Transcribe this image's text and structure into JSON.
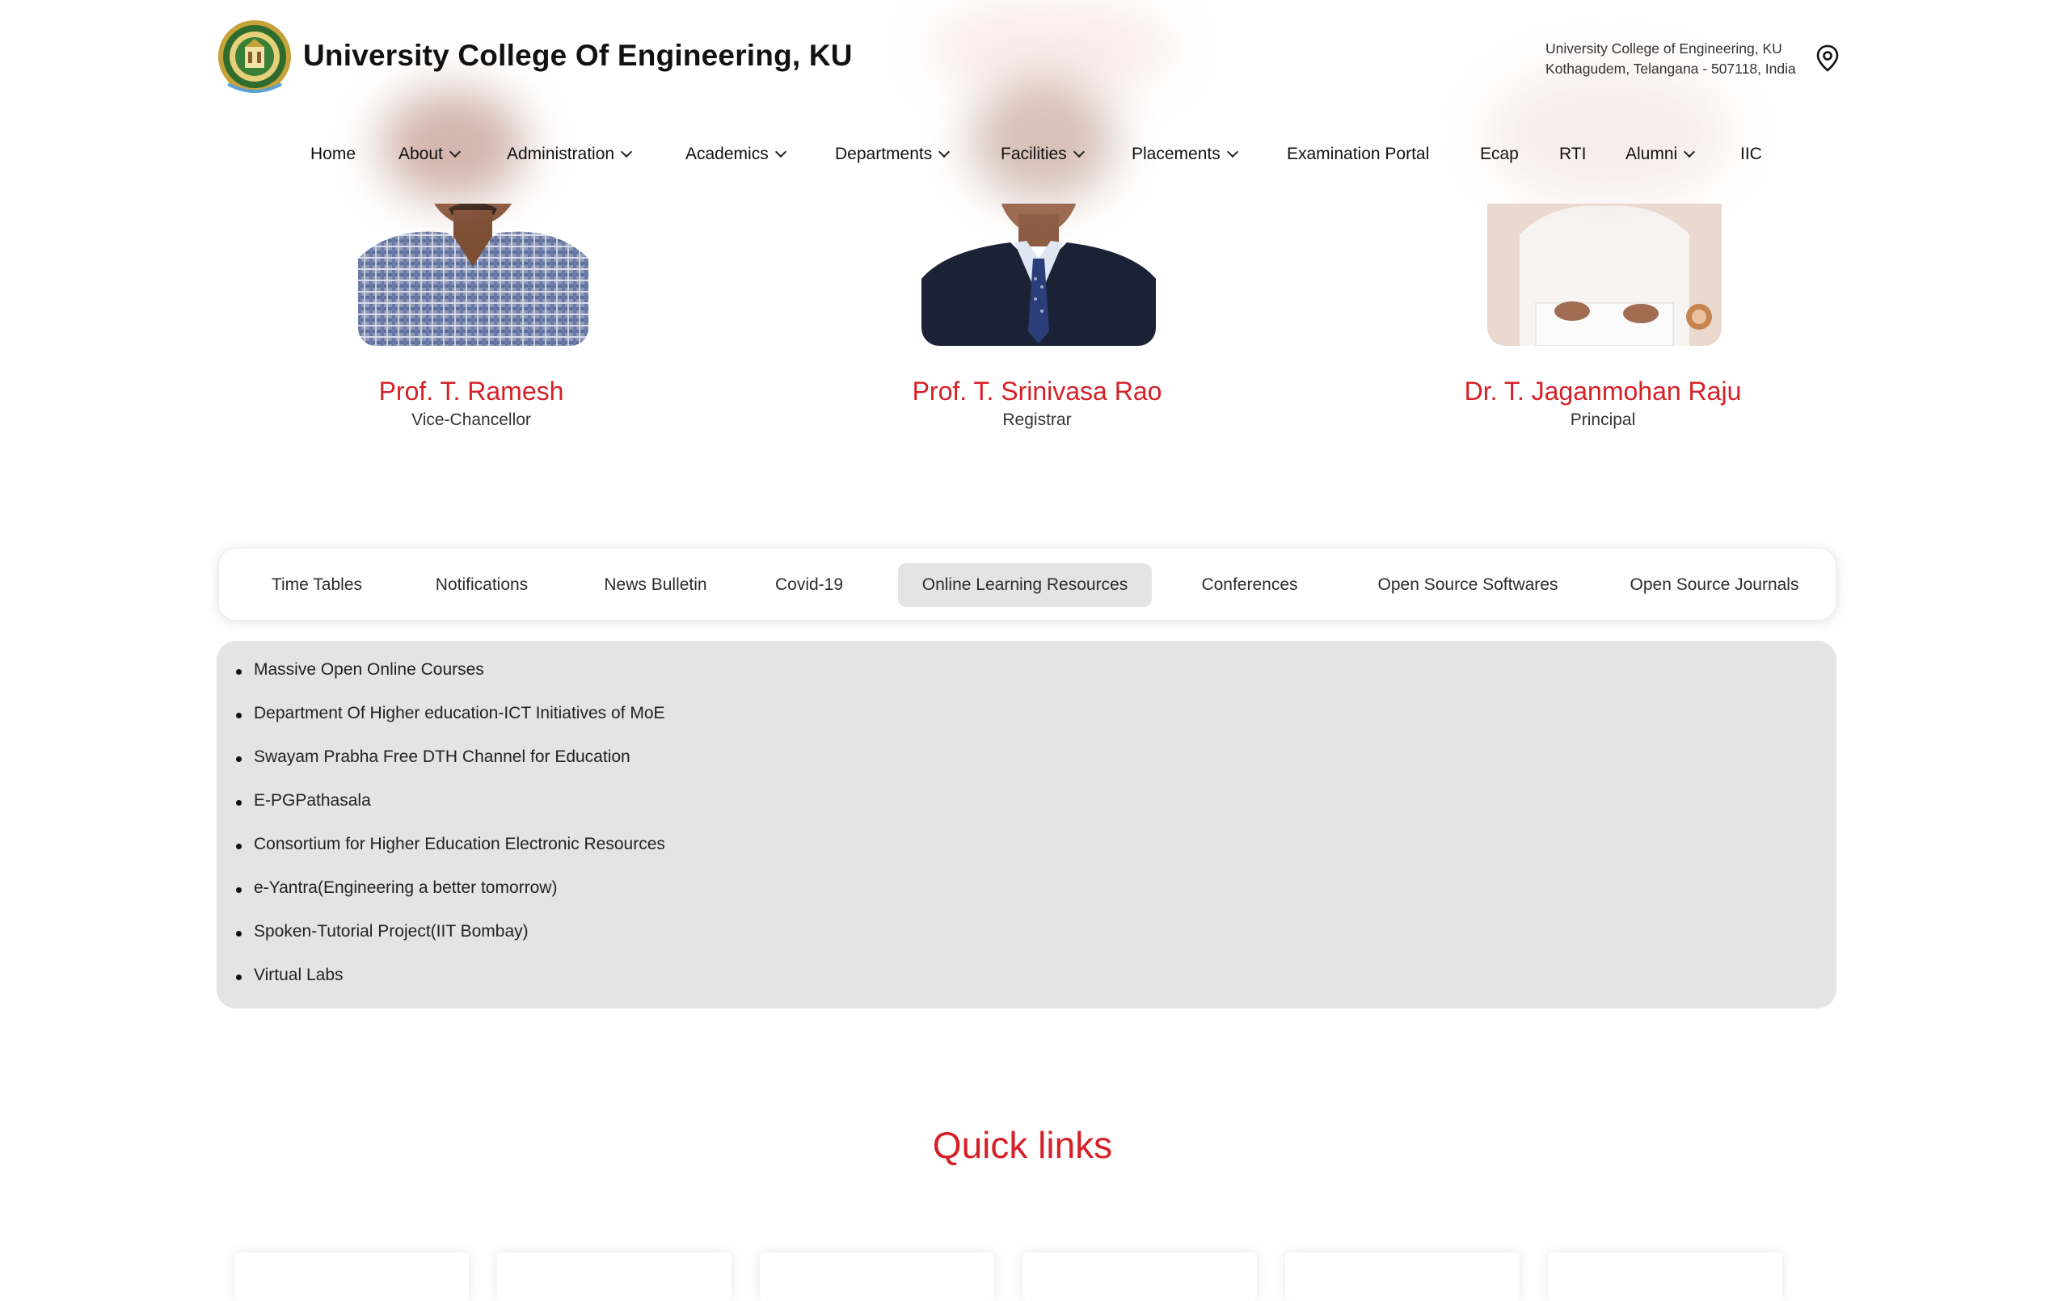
{
  "header": {
    "title": "University College Of Engineering, KU",
    "address_line1": "University College of Engineering, KU",
    "address_line2": "Kothagudem, Telangana - 507118, India"
  },
  "nav": {
    "items": [
      {
        "label": "Home",
        "dropdown": false
      },
      {
        "label": "About",
        "dropdown": true
      },
      {
        "label": "Administration",
        "dropdown": true
      },
      {
        "label": "Academics",
        "dropdown": true
      },
      {
        "label": "Departments",
        "dropdown": true
      },
      {
        "label": "Facilities",
        "dropdown": true
      },
      {
        "label": "Placements",
        "dropdown": true
      },
      {
        "label": "Examination Portal",
        "dropdown": false
      },
      {
        "label": "Ecap",
        "dropdown": false
      },
      {
        "label": "RTI",
        "dropdown": false
      },
      {
        "label": "Alumni",
        "dropdown": true
      },
      {
        "label": "IIC",
        "dropdown": false
      }
    ]
  },
  "leaders": [
    {
      "name": "Prof. T. Ramesh",
      "role": "Vice-Chancellor"
    },
    {
      "name": "Prof. T. Srinivasa Rao",
      "role": "Registrar"
    },
    {
      "name": "Dr. T. Jaganmohan Raju",
      "role": "Principal"
    }
  ],
  "tabs": {
    "items": [
      {
        "label": "Time Tables"
      },
      {
        "label": "Notifications"
      },
      {
        "label": "News Bulletin"
      },
      {
        "label": "Covid-19"
      },
      {
        "label": "Online Learning Resources"
      },
      {
        "label": "Conferences"
      },
      {
        "label": "Open Source Softwares"
      },
      {
        "label": "Open Source Journals"
      }
    ],
    "active": "Online Learning Resources"
  },
  "resources": [
    "Massive Open Online Courses",
    "Department Of Higher education-ICT Initiatives of MoE",
    "Swayam Prabha Free DTH Channel for Education",
    "E-PGPathasala",
    "Consortium for Higher Education Electronic Resources",
    "e-Yantra(Engineering a better tomorrow)",
    "Spoken-Tutorial Project(IIT Bombay)",
    "Virtual Labs"
  ],
  "quick_links": {
    "title": "Quick links"
  },
  "colors": {
    "accent": "#d62027",
    "panel_bg": "#e4e4e4",
    "active_tab": "#e4e4e4"
  },
  "icons": {
    "location": "location-pin-icon",
    "logo": "university-seal-logo"
  }
}
